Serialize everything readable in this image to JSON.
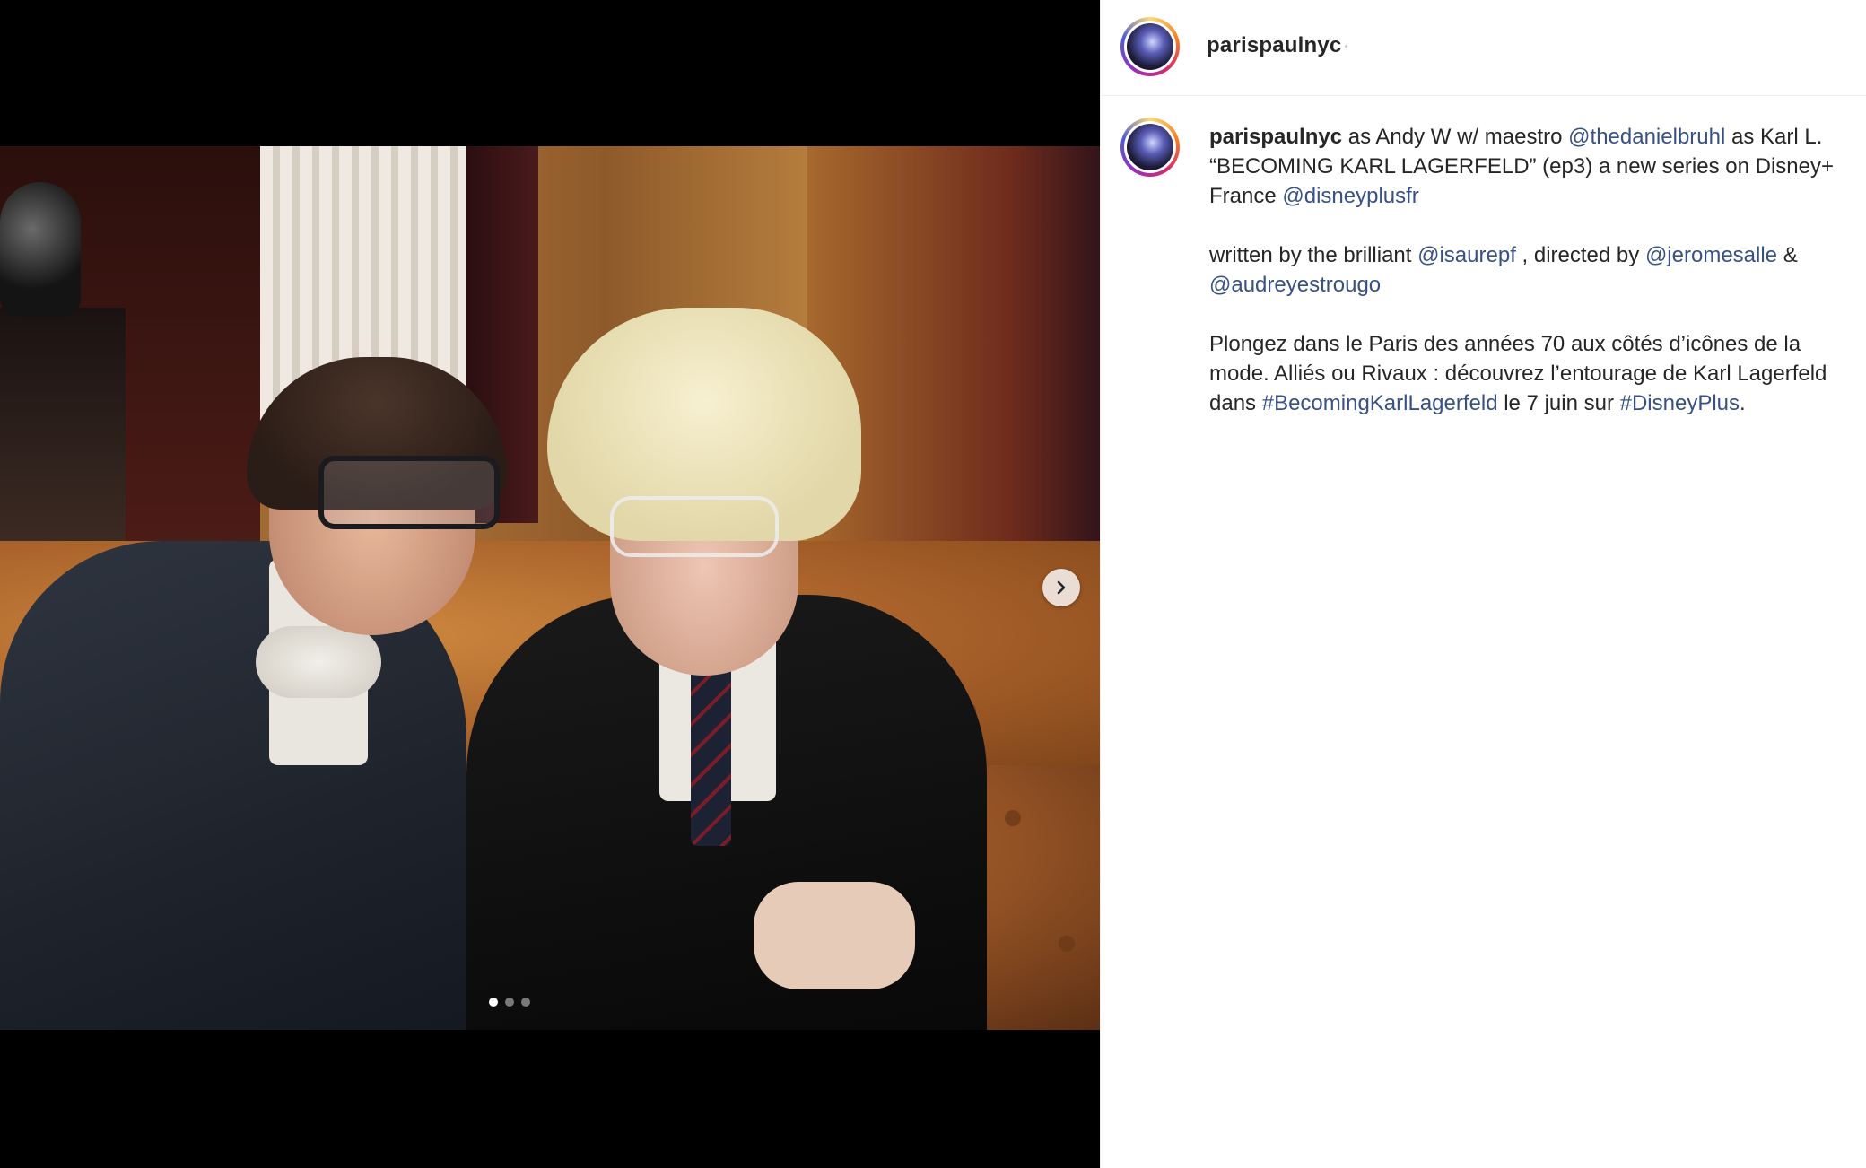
{
  "post": {
    "username": "parispaulnyc",
    "media": {
      "current_slide": 1,
      "slide_count": 3
    },
    "caption": {
      "line1": {
        "text_a": " as Andy W w/ maestro ",
        "mention_a": "@thedanielbruhl",
        "text_b": " as Karl L. “BECOMING KARL LAGERFELD” (ep3) a new series on Disney+ France ",
        "mention_b": "@disneyplusfr"
      },
      "line2": {
        "text_a": "written by the brilliant ",
        "mention_a": "@isaurepf",
        "text_b": " , directed by ",
        "mention_b": "@jeromesalle",
        "text_c": " & ",
        "mention_c": "@audreyestrougo"
      },
      "line3": {
        "text_a": "Plongez dans le Paris des années 70 aux côtés d’icônes de la mode. Alliés ou Rivaux : découvrez l’entourage de Karl Lagerfeld dans ",
        "hashtag_a": "#BecomingKarlLagerfeld",
        "text_b": " le 7 juin sur ",
        "hashtag_b": "#DisneyPlus",
        "text_c": "."
      }
    }
  },
  "colors": {
    "link": "#385185",
    "text": "#262626",
    "media_bg": "#000000"
  },
  "icons": {
    "next": "chevron-right-icon",
    "avatar": "profile-avatar"
  }
}
